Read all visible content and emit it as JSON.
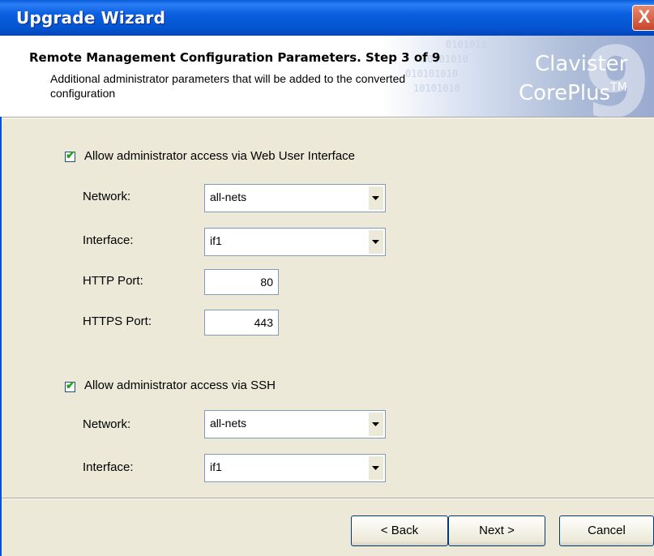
{
  "window": {
    "title": "Upgrade Wizard",
    "close_glyph": "X"
  },
  "header": {
    "title": "Remote Management Configuration Parameters. Step 3 of 9",
    "subtitle": "Additional administrator parameters that will be added to the converted configuration",
    "brand_line1": "Clavister",
    "brand_line2": "CorePlus",
    "brand_tm": "TM",
    "brand_number": "9"
  },
  "web": {
    "checkbox_label": "Allow administrator access via Web User Interface",
    "checked": true,
    "network_label": "Network:",
    "network_value": "all-nets",
    "interface_label": "Interface:",
    "interface_value": "if1",
    "http_label": "HTTP Port:",
    "http_value": "80",
    "https_label": "HTTPS Port:",
    "https_value": "443"
  },
  "ssh": {
    "checkbox_label": "Allow administrator access via SSH",
    "checked": true,
    "network_label": "Network:",
    "network_value": "all-nets",
    "interface_label": "Interface:",
    "interface_value": "if1"
  },
  "buttons": {
    "back": "< Back",
    "next": "Next >",
    "cancel": "Cancel"
  },
  "colors": {
    "titlebar": "#0553d0",
    "dialog_bg": "#ece9d8",
    "check": "#21a121"
  }
}
